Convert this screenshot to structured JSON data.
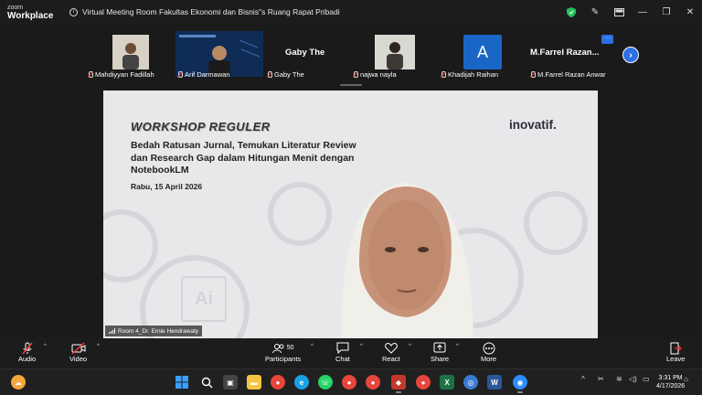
{
  "app": {
    "brand_small": "zoom",
    "brand_name": "Workplace"
  },
  "meeting": {
    "title": "Virtual Meeting Room Fakultas Ekonomi dan Bisnis\"s Ruang Rapat Pribadi"
  },
  "participants": [
    {
      "name": "Mahdiyyan Fadillah"
    },
    {
      "name": "Arif Darmawan"
    },
    {
      "name": "Gaby The",
      "display": "Gaby The"
    },
    {
      "name": "najwa nayla"
    },
    {
      "name": "Khadijah Raihan",
      "initial": "A"
    },
    {
      "name": "M.Farrel Razan Anwar",
      "display": "M.Farrel Razan..."
    }
  ],
  "slide": {
    "heading": "WORKSHOP REGULER",
    "topic": "Bedah Ratusan Jurnal, Temukan Literatur Review dan Research Gap dalam Hitungan Menit dengan NotebookLM",
    "date": "Rabu, 15 April 2026",
    "logo": "inovatif.",
    "ai_text": "Ai"
  },
  "speaker": {
    "label": "Room 4_Dr. Ernie Hendrawaty"
  },
  "toolbar": {
    "audio": "Audio",
    "video": "Video",
    "participants": "Participants",
    "participants_count": "50",
    "chat": "Chat",
    "react": "React",
    "share": "Share",
    "more": "More",
    "leave": "Leave"
  },
  "taskbar": {
    "time": "3:31 PM",
    "date": "4/17/2026"
  },
  "colors": {
    "accent": "#2f6fe4",
    "leave": "#e02828",
    "shield": "#20c25a"
  }
}
